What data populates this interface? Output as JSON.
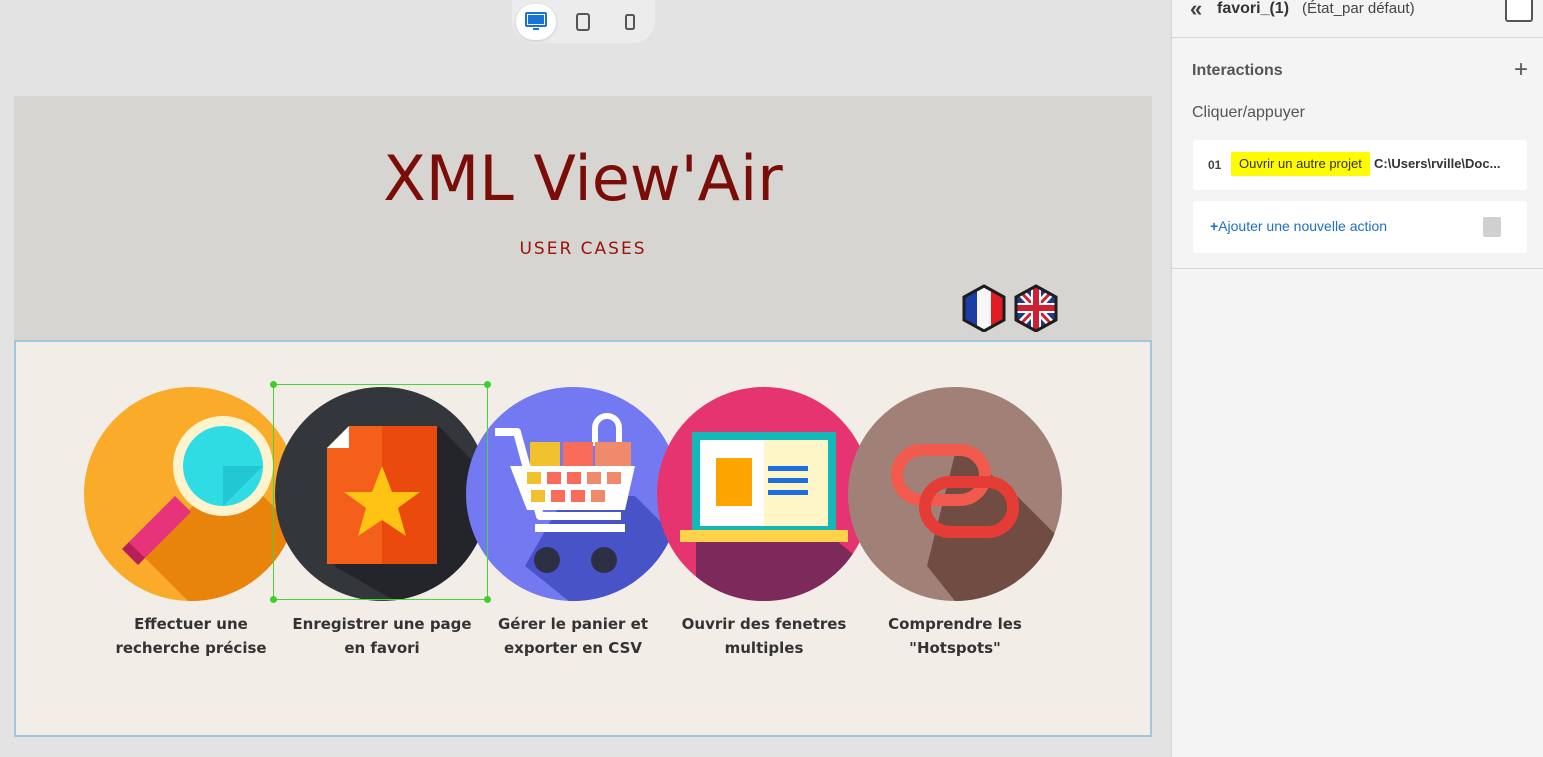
{
  "device_toggle": {
    "icons": [
      "desktop-icon",
      "tablet-icon",
      "phone-icon"
    ],
    "active": "desktop"
  },
  "canvas": {
    "title": "XML View'Air",
    "subtitle": "USER CASES",
    "flags": [
      "france-flag-icon",
      "uk-flag-icon"
    ],
    "cases": [
      {
        "label_line1": "Effectuer une",
        "label_line2": "recherche précise",
        "icon": "magnifier-icon",
        "color": "#fbab2a"
      },
      {
        "label_line1": "Enregistrer une page",
        "label_line2": "en favori",
        "icon": "favorite-page-icon",
        "color": "#2f3136"
      },
      {
        "label_line1": "Gérer le panier et",
        "label_line2": "exporter en CSV",
        "icon": "shopping-cart-icon",
        "color": "#7379f0"
      },
      {
        "label_line1": "Ouvrir des fenetres",
        "label_line2": "multiples",
        "icon": "laptop-window-icon",
        "color": "#e63470"
      },
      {
        "label_line1": "Comprendre les",
        "label_line2": "\"Hotspots\"",
        "icon": "link-icon",
        "color": "#a08077"
      }
    ]
  },
  "panel": {
    "object_name": "favori_(1)",
    "object_state": "(État_par défaut)",
    "section_title": "Interactions",
    "trigger": "Cliquer/appuyer",
    "actions": [
      {
        "number": "01",
        "label": "Ouvrir un autre projet",
        "path": "C:\\Users\\rville\\Doc..."
      }
    ],
    "add_action_label": "Ajouter une nouvelle action",
    "add_action_prefix": "+"
  }
}
